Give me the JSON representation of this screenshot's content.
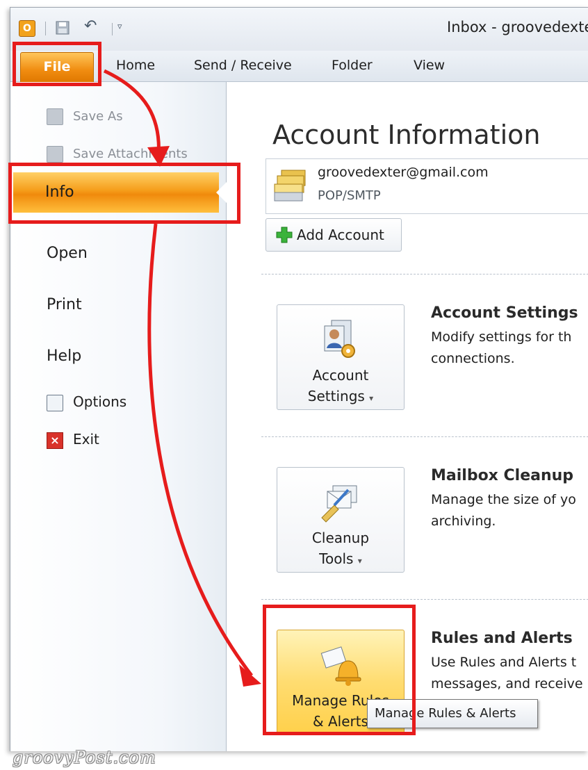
{
  "titlebar": {
    "app_icon_letter": "O",
    "title": "Inbox - groovedexter@gmail"
  },
  "ribbon": {
    "tabs": [
      {
        "label": "File"
      },
      {
        "label": "Home"
      },
      {
        "label": "Send / Receive"
      },
      {
        "label": "Folder"
      },
      {
        "label": "View"
      }
    ]
  },
  "nav": {
    "save_as": "Save As",
    "save_attachments": "Save Attachments",
    "info": "Info",
    "open": "Open",
    "print": "Print",
    "help": "Help",
    "options": "Options",
    "exit": "Exit"
  },
  "content": {
    "title": "Account Information",
    "account": {
      "email": "groovedexter@gmail.com",
      "type": "POP/SMTP"
    },
    "add_account": "Add Account",
    "sections": [
      {
        "button_line1": "Account",
        "button_line2": "Settings",
        "title": "Account Settings",
        "desc_line1": "Modify settings for th",
        "desc_line2": "connections."
      },
      {
        "button_line1": "Cleanup",
        "button_line2": "Tools",
        "title": "Mailbox Cleanup",
        "desc_line1": "Manage the size of yo",
        "desc_line2": "archiving."
      },
      {
        "button_line1": "Manage Rules",
        "button_line2": "& Alerts",
        "title": "Rules and Alerts",
        "desc_line1": "Use Rules and Alerts t",
        "desc_line2": "messages, and receive"
      }
    ],
    "tooltip": "Manage Rules & Alerts"
  },
  "watermark": "groovyPost.com",
  "colors": {
    "accent_orange": "#f59d1a",
    "highlight_red": "#e61c1c"
  }
}
